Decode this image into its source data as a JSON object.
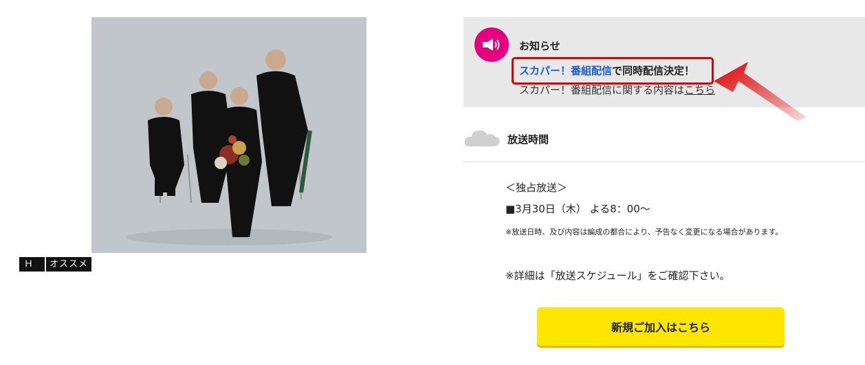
{
  "tags": [
    "ＨＤ",
    "オススメ"
  ],
  "notice": {
    "heading": "お知らせ",
    "line1_link": "スカパー！番組配信",
    "line1_rest": "で同時配信決定！",
    "line2_text": "スカパー！番組配信に関する内容は",
    "line2_link": "こちら"
  },
  "broadcast": {
    "title": "放送時間",
    "lines": [
      "＜独占放送＞",
      "■3月30日（木） よる8：00～",
      "※放送日時、及び内容は編成の都合により、予告なく変更になる場合があります。",
      "※詳細は「放送スケジュール」をご確認下さい。"
    ]
  },
  "cta": {
    "label": "新規ご加入はこちら"
  },
  "colors": {
    "accent": "#e4007f",
    "highlight": "#e10000",
    "link": "#1a5fd6",
    "button": "#ffe600"
  }
}
